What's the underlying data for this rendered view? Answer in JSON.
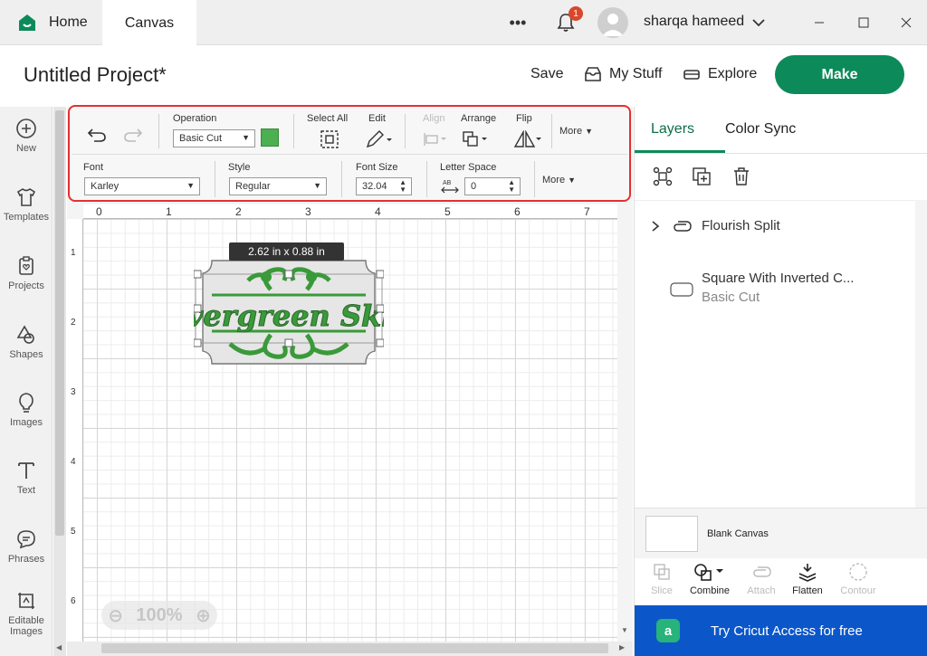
{
  "titlebar": {
    "tabs": [
      {
        "label": "Home"
      },
      {
        "label": "Canvas"
      }
    ],
    "notification_count": "1",
    "user_name": "sharqa hameed"
  },
  "header": {
    "project_title": "Untitled Project*",
    "save_label": "Save",
    "my_stuff_label": "My Stuff",
    "explore_label": "Explore",
    "make_label": "Make"
  },
  "sidebar": {
    "items": [
      {
        "label": "New",
        "icon": "plus-circle-icon"
      },
      {
        "label": "Templates",
        "icon": "shirt-icon"
      },
      {
        "label": "Projects",
        "icon": "clipboard-heart-icon"
      },
      {
        "label": "Shapes",
        "icon": "shapes-icon"
      },
      {
        "label": "Images",
        "icon": "lightbulb-icon"
      },
      {
        "label": "Text",
        "icon": "text-t-icon"
      },
      {
        "label": "Phrases",
        "icon": "chat-bubble-icon"
      },
      {
        "label": "Editable Images",
        "icon": "editable-image-icon"
      }
    ]
  },
  "toolbar": {
    "operation_label": "Operation",
    "operation_value": "Basic Cut",
    "operation_color": "#4caf50",
    "select_all_label": "Select All",
    "edit_label": "Edit",
    "align_label": "Align",
    "arrange_label": "Arrange",
    "flip_label": "Flip",
    "more_label_1": "More",
    "font_label": "Font",
    "font_value": "Karley",
    "style_label": "Style",
    "style_value": "Regular",
    "font_size_label": "Font Size",
    "font_size_value": "32.04",
    "letter_space_label": "Letter Space",
    "letter_space_value": "0",
    "more_label_2": "More"
  },
  "canvas": {
    "ruler_top": [
      "0",
      "1",
      "2",
      "3",
      "4",
      "5",
      "6",
      "7"
    ],
    "ruler_left": [
      "1",
      "2",
      "3",
      "4",
      "5",
      "6"
    ],
    "design_text": "Evergreen Skin",
    "size_tooltip": "2.62  in x 0.88  in",
    "zoom_value": "100%"
  },
  "right_panel": {
    "tabs": [
      {
        "label": "Layers"
      },
      {
        "label": "Color Sync"
      }
    ],
    "layers": [
      {
        "name": "Flourish Split",
        "icon": "chain-link-icon"
      },
      {
        "name": "Square With Inverted C...",
        "sub": "Basic Cut",
        "icon": "rounded-rect-icon"
      }
    ],
    "blank_canvas_label": "Blank Canvas",
    "bottom_tools": [
      {
        "label": "Slice"
      },
      {
        "label": "Combine"
      },
      {
        "label": "Attach"
      },
      {
        "label": "Flatten"
      },
      {
        "label": "Contour"
      }
    ],
    "access_banner": "Try Cricut Access for free"
  },
  "colors": {
    "brand_green": "#0d8a5a",
    "access_blue": "#0b57c9",
    "highlight_red": "#e53030",
    "design_green": "#3a9a3a"
  }
}
